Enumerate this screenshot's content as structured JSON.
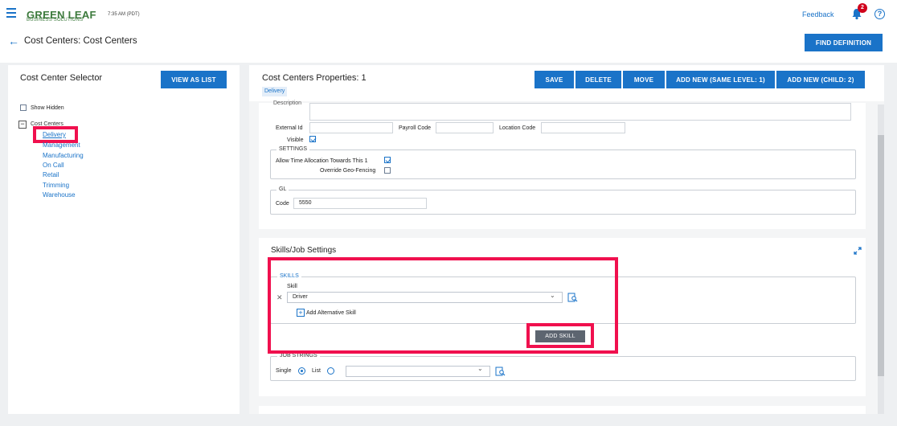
{
  "header": {
    "logo_main": "GREEN LEAF",
    "logo_sub": "BUSINESS SOLUTIONS",
    "time": "7:35 AM (PDT)",
    "feedback": "Feedback",
    "notification_count": "2",
    "help": "?"
  },
  "page": {
    "title": "Cost Centers: Cost Centers",
    "find_definition": "FIND DEFINITION"
  },
  "selector": {
    "title": "Cost Center Selector",
    "view_as_list": "VIEW AS LIST",
    "show_hidden": "Show Hidden",
    "root_label": "Cost Centers",
    "items": [
      "Delivery",
      "Management",
      "Manufacturing",
      "On Call",
      "Retail",
      "Trimming",
      "Warehouse"
    ]
  },
  "properties": {
    "title": "Cost Centers Properties: 1",
    "tag": "Delivery",
    "buttons": {
      "save": "SAVE",
      "delete": "DELETE",
      "move": "MOVE",
      "add_same": "ADD NEW (SAME LEVEL: 1)",
      "add_child": "ADD NEW (CHILD: 2)"
    },
    "description_label": "Description",
    "external_id_label": "External Id",
    "payroll_code_label": "Payroll Code",
    "location_code_label": "Location Code",
    "visible_label": "Visible",
    "settings_legend": "SETTINGS",
    "allow_time_label": "Allow Time Allocation Towards This 1",
    "override_geo_label": "Override Geo-Fencing",
    "gl_legend": "GL",
    "code_label": "Code",
    "code_value": "5550"
  },
  "skills": {
    "title": "Skills/Job Settings",
    "skills_legend": "SKILLS",
    "skill_label": "Skill",
    "skill_value": "Driver",
    "add_alternative": "Add Alternative Skill",
    "add_skill": "ADD SKILL",
    "job_strings_legend": "JOB STRINGS",
    "single_label": "Single",
    "list_label": "List"
  },
  "colors": {
    "accent": "#1a73c8",
    "highlight": "#f0104e",
    "badge": "#d0021b"
  }
}
